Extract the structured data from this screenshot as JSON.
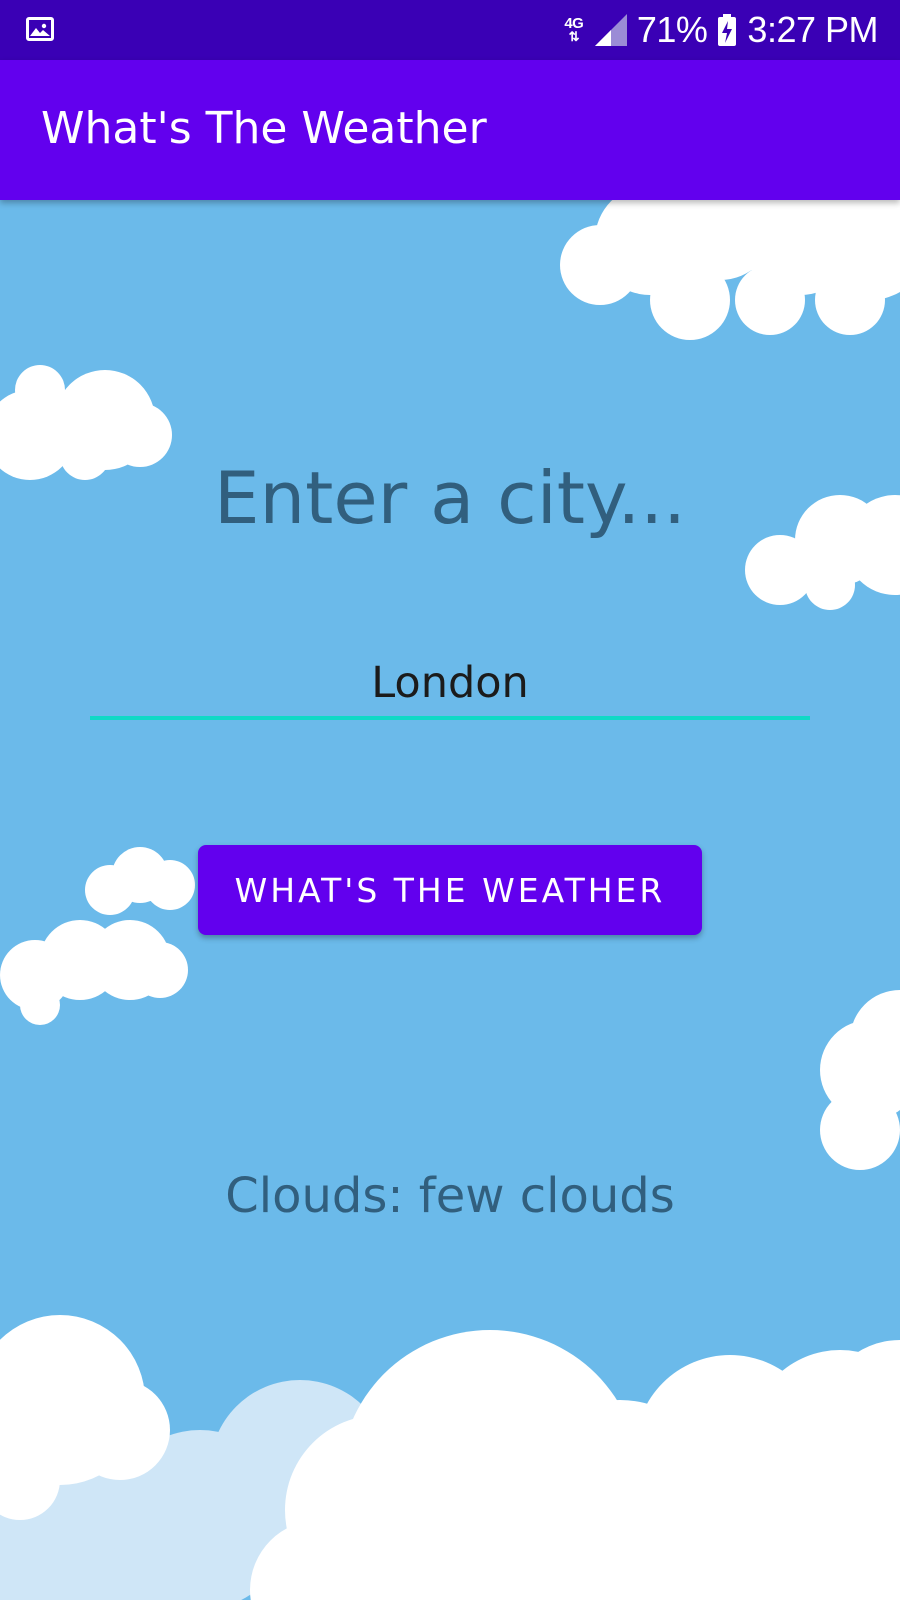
{
  "status_bar": {
    "network": "4G",
    "battery": "71%",
    "time": "3:27 PM",
    "icons": [
      "gallery-notification-icon",
      "network-4g-icon",
      "signal-strength-icon",
      "battery-charging-icon"
    ]
  },
  "app_bar": {
    "title": "What's The Weather"
  },
  "main": {
    "prompt": "Enter a city...",
    "city_input": {
      "value": "London"
    },
    "button_label": "WHAT'S THE WEATHER",
    "result_text": "Clouds: few clouds"
  },
  "colors": {
    "status_bar": "#3a00b5",
    "app_bar": "#6200ee",
    "sky": "#6bbaea",
    "accent_underline": "#10d9c6",
    "text_dim": "#315f7e"
  }
}
